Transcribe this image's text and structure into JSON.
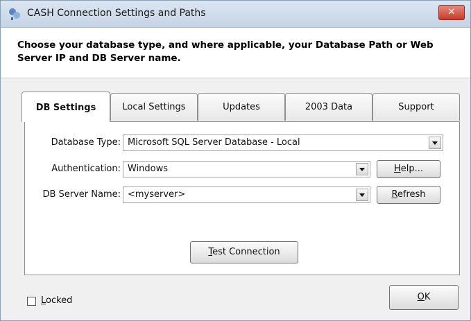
{
  "window": {
    "title": "CASH Connection Settings and Paths",
    "close_glyph": "✕"
  },
  "header": {
    "instructions": "Choose your database type, and where applicable, your Database Path or Web Server IP and DB Server name."
  },
  "tabs": [
    {
      "label": "DB Settings",
      "active": true
    },
    {
      "label": "Local Settings",
      "active": false
    },
    {
      "label": "Updates",
      "active": false
    },
    {
      "label": "2003 Data",
      "active": false
    },
    {
      "label": "Support",
      "active": false
    }
  ],
  "db_settings": {
    "database_type_label": "Database Type:",
    "database_type_value": "Microsoft SQL Server Database - Local",
    "authentication_label": "Authentication:",
    "authentication_value": "Windows",
    "server_name_label": "DB Server Name:",
    "server_name_value": "<myserver>",
    "help_button": {
      "accel": "H",
      "rest": "elp..."
    },
    "refresh_button": {
      "accel": "R",
      "rest": "efresh"
    },
    "test_button": {
      "accel": "T",
      "rest": "est Connection"
    }
  },
  "footer": {
    "locked_label": {
      "accel": "L",
      "rest": "ocked"
    },
    "locked_checked": false,
    "ok_button": {
      "accel": "O",
      "rest": "K"
    }
  },
  "colors": {
    "titlebar": "#c4d3e4",
    "close_button": "#c43c2a",
    "panel": "#ffffff",
    "dialog": "#f0f0f0"
  }
}
